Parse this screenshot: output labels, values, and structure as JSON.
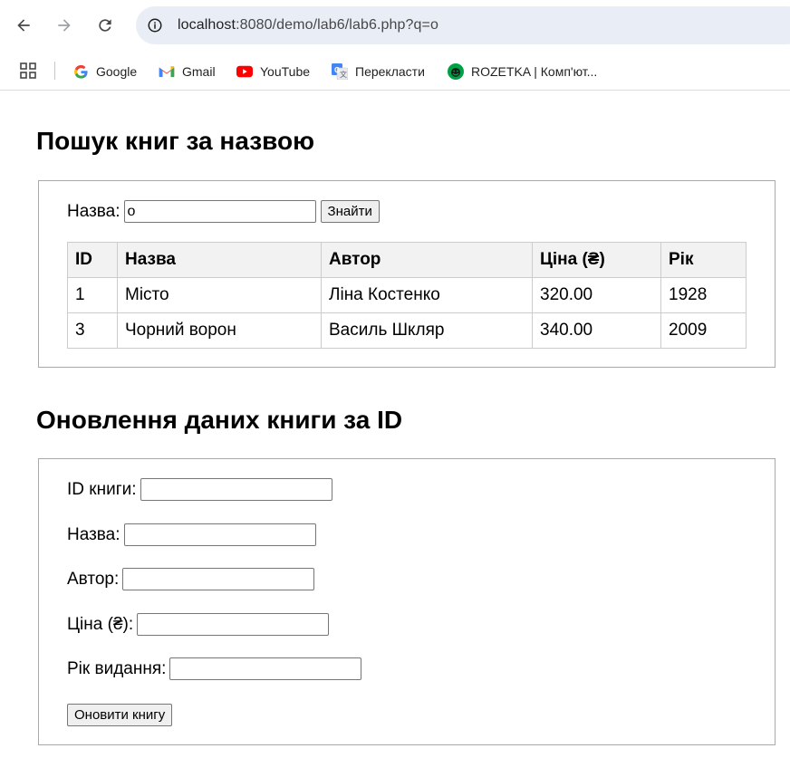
{
  "browser": {
    "url_host": "localhost",
    "url_rest": ":8080/demo/lab6/lab6.php?q=o",
    "bookmarks": [
      {
        "label": "Google",
        "icon": "google-icon"
      },
      {
        "label": "Gmail",
        "icon": "gmail-icon"
      },
      {
        "label": "YouTube",
        "icon": "youtube-icon"
      },
      {
        "label": "Перекласти",
        "icon": "translate-icon"
      },
      {
        "label": "ROZETKA | Комп'ют...",
        "icon": "rozetka-icon"
      }
    ]
  },
  "search": {
    "heading": "Пошук книг за назвою",
    "label": "Назва:",
    "value": "о",
    "button": "Знайти",
    "columns": [
      "ID",
      "Назва",
      "Автор",
      "Ціна (₴)",
      "Рік"
    ],
    "rows": [
      [
        "1",
        "Місто",
        "Ліна Костенко",
        "320.00",
        "1928"
      ],
      [
        "3",
        "Чорний ворон",
        "Василь Шкляр",
        "340.00",
        "2009"
      ]
    ]
  },
  "update": {
    "heading": "Оновлення даних книги за ID",
    "id_label": "ID книги:",
    "title_label": "Назва:",
    "author_label": "Автор:",
    "price_label": "Ціна (₴):",
    "year_label": "Рік видання:",
    "id_value": "",
    "title_value": "",
    "author_value": "",
    "price_value": "",
    "year_value": "",
    "button": "Оновити книгу"
  }
}
